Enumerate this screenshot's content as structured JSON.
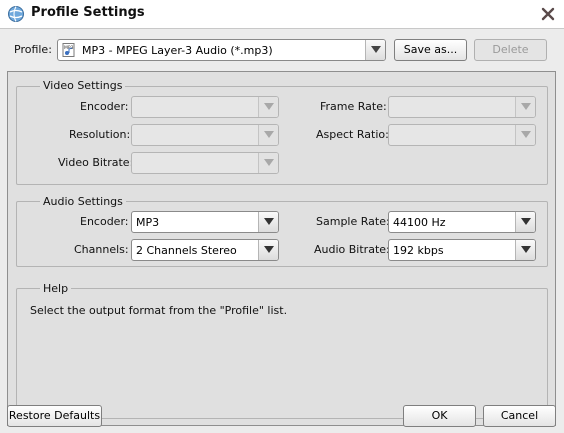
{
  "window": {
    "title": "Profile Settings"
  },
  "profile": {
    "label": "Profile:",
    "value": "MP3 - MPEG Layer-3 Audio (*.mp3)",
    "save_as_label": "Save as...",
    "delete_label": "Delete"
  },
  "video": {
    "title": "Video Settings",
    "encoder_label": "Encoder:",
    "resolution_label": "Resolution:",
    "bitrate_label": "Video Bitrate:",
    "frame_rate_label": "Frame Rate:",
    "aspect_ratio_label": "Aspect Ratio:"
  },
  "audio": {
    "title": "Audio Settings",
    "encoder_label": "Encoder:",
    "encoder_value": "MP3",
    "channels_label": "Channels:",
    "channels_value": "2 Channels Stereo",
    "sample_rate_label": "Sample Rate:",
    "sample_rate_value": "44100 Hz",
    "bitrate_label": "Audio Bitrate:",
    "bitrate_value": "192 kbps"
  },
  "help": {
    "title": "Help",
    "text": "Select the output format from the \"Profile\" list."
  },
  "footer": {
    "restore_label": "Restore Defaults",
    "ok_label": "OK",
    "cancel_label": "Cancel"
  },
  "icons": {
    "app": "app-globe-icon",
    "close": "close-icon",
    "profile_type": "mp3-file-icon",
    "dropdown": "chevron-down-icon"
  },
  "colors": {
    "dialog_bg": "#ececec",
    "panel_bg": "#e0e0e0",
    "close_x": "#5a4a4a",
    "disabled_text": "#9a9a9a"
  }
}
